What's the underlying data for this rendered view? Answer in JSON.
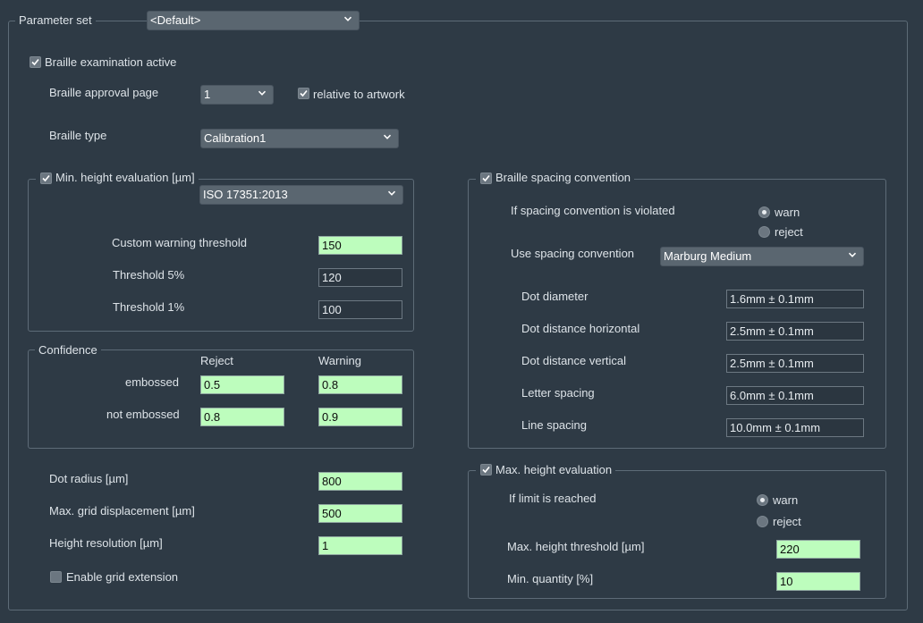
{
  "header": {
    "param_set_label": "Parameter set",
    "param_set_value": "<Default>"
  },
  "braille": {
    "active_label": "Braille examination active",
    "approval_page_label": "Braille approval page",
    "approval_page_value": "1",
    "relative_label": "relative to artwork",
    "type_label": "Braille type",
    "type_value": "Calibration1"
  },
  "min_height": {
    "title": "Min. height evaluation [µm]",
    "standard_value": "ISO 17351:2013",
    "custom_warning_label": "Custom warning threshold",
    "custom_warning_value": "150",
    "threshold5_label": "Threshold 5%",
    "threshold5_value": "120",
    "threshold1_label": "Threshold 1%",
    "threshold1_value": "100"
  },
  "confidence": {
    "title": "Confidence",
    "col_reject": "Reject",
    "col_warning": "Warning",
    "embossed_label": "embossed",
    "embossed_reject": "0.5",
    "embossed_warning": "0.8",
    "not_embossed_label": "not embossed",
    "not_embossed_reject": "0.8",
    "not_embossed_warning": "0.9"
  },
  "dot": {
    "radius_label": "Dot radius [µm]",
    "radius_value": "800",
    "grid_disp_label": "Max. grid displacement [µm]",
    "grid_disp_value": "500",
    "height_res_label": "Height resolution [µm]",
    "height_res_value": "1",
    "grid_ext_label": "Enable grid extension"
  },
  "spacing": {
    "title": "Braille spacing convention",
    "violated_label": "If spacing convention is violated",
    "warn_label": "warn",
    "reject_label": "reject",
    "use_label": "Use spacing convention",
    "use_value": "Marburg Medium",
    "dot_diameter_label": "Dot diameter",
    "dot_diameter_value": "1.6mm ± 0.1mm",
    "dot_dist_h_label": "Dot distance horizontal",
    "dot_dist_h_value": "2.5mm ± 0.1mm",
    "dot_dist_v_label": "Dot distance vertical",
    "dot_dist_v_value": "2.5mm ± 0.1mm",
    "letter_spacing_label": "Letter spacing",
    "letter_spacing_value": "6.0mm ± 0.1mm",
    "line_spacing_label": "Line spacing",
    "line_spacing_value": "10.0mm ± 0.1mm"
  },
  "max_height": {
    "title": "Max. height evaluation",
    "limit_label": "If limit is reached",
    "warn_label": "warn",
    "reject_label": "reject",
    "threshold_label": "Max. height threshold [µm]",
    "threshold_value": "220",
    "quantity_label": "Min. quantity [%]",
    "quantity_value": "10"
  }
}
